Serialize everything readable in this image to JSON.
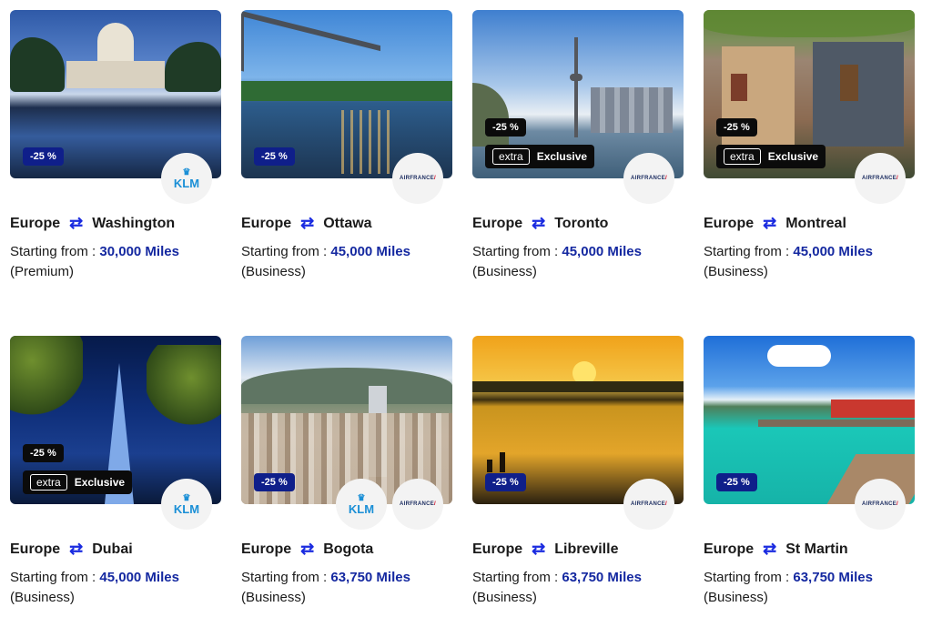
{
  "cards": [
    {
      "origin": "Europe",
      "destination": "Washington",
      "discount": "-25 %",
      "exclusive": false,
      "price_label": "Starting from : ",
      "miles": "30,000 Miles",
      "cabin": "(Premium)",
      "airlines": [
        "KLM"
      ]
    },
    {
      "origin": "Europe",
      "destination": "Ottawa",
      "discount": "-25 %",
      "exclusive": false,
      "price_label": "Starting from : ",
      "miles": "45,000 Miles",
      "cabin": "(Business)",
      "airlines": [
        "AIRFRANCE"
      ]
    },
    {
      "origin": "Europe",
      "destination": "Toronto",
      "discount": "-25 %",
      "exclusive": true,
      "exclusive_tag": "extra",
      "exclusive_label": "Exclusive",
      "price_label": "Starting from : ",
      "miles": "45,000 Miles",
      "cabin": "(Business)",
      "airlines": [
        "AIRFRANCE"
      ]
    },
    {
      "origin": "Europe",
      "destination": "Montreal",
      "discount": "-25 %",
      "exclusive": true,
      "exclusive_tag": "extra",
      "exclusive_label": "Exclusive",
      "price_label": "Starting from : ",
      "miles": "45,000 Miles",
      "cabin": "(Business)",
      "airlines": [
        "AIRFRANCE"
      ]
    },
    {
      "origin": "Europe",
      "destination": "Dubai",
      "discount": "-25 %",
      "exclusive": true,
      "exclusive_tag": "extra",
      "exclusive_label": "Exclusive",
      "price_label": "Starting from : ",
      "miles": "45,000 Miles",
      "cabin": "(Business)",
      "airlines": [
        "KLM"
      ]
    },
    {
      "origin": "Europe",
      "destination": "Bogota",
      "discount": "-25 %",
      "exclusive": false,
      "price_label": "Starting from : ",
      "miles": "63,750 Miles",
      "cabin": "(Business)",
      "airlines": [
        "KLM",
        "AIRFRANCE"
      ]
    },
    {
      "origin": "Europe",
      "destination": "Libreville",
      "discount": "-25 %",
      "exclusive": false,
      "price_label": "Starting from : ",
      "miles": "63,750 Miles",
      "cabin": "(Business)",
      "airlines": [
        "AIRFRANCE"
      ]
    },
    {
      "origin": "Europe",
      "destination": "St Martin",
      "discount": "-25 %",
      "exclusive": false,
      "price_label": "Starting from : ",
      "miles": "63,750 Miles",
      "cabin": "(Business)",
      "airlines": [
        "AIRFRANCE"
      ]
    }
  ],
  "logos": {
    "klm_text": "KLM",
    "airfrance_text": "AIRFRANCE",
    "airfrance_mark": "/"
  },
  "colors": {
    "discount_badge": "#0f1f8a",
    "miles_text": "#1428a0",
    "swap_icon": "#1a2be0"
  }
}
